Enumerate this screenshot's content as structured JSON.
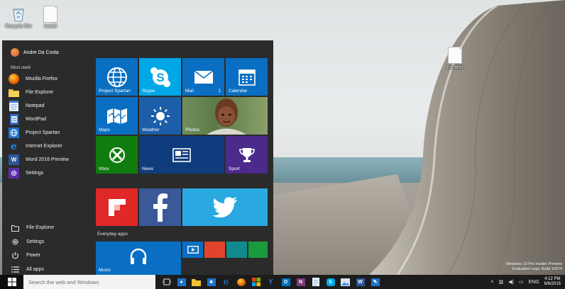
{
  "desktop": {
    "icons": [
      {
        "label": "Recycle Bin"
      },
      {
        "label": "install"
      },
      {
        "label": "contest"
      }
    ],
    "watermark_line1": "Windows 10 Pro Insider Preview",
    "watermark_line2": "Evaluation copy. Build 10074"
  },
  "start_menu": {
    "user_name": "Andre Da Costa",
    "most_used_label": "Most used",
    "most_used": [
      {
        "label": "Mozilla Firefox",
        "icon": "firefox-icon",
        "color": "#e66000"
      },
      {
        "label": "File Explorer",
        "icon": "folder-icon",
        "color": "#f1c232"
      },
      {
        "label": "Notepad",
        "icon": "notepad-icon",
        "color": "#3c7fd3"
      },
      {
        "label": "WordPad",
        "icon": "wordpad-icon",
        "color": "#2f6ec8"
      },
      {
        "label": "Project Spartan",
        "icon": "globe-icon",
        "color": "#1e73c8"
      },
      {
        "label": "Internet Explorer",
        "icon": "ie-icon",
        "color": "#1c8ae6"
      },
      {
        "label": "Word 2016 Preview",
        "icon": "word-icon",
        "color": "#2b579a"
      },
      {
        "label": "Settings",
        "icon": "gear-icon",
        "color": "#5a2ea6"
      }
    ],
    "bottom": [
      {
        "label": "File Explorer",
        "icon": "folder-icon"
      },
      {
        "label": "Settings",
        "icon": "gear-icon"
      },
      {
        "label": "Power",
        "icon": "power-icon"
      },
      {
        "label": "All apps",
        "icon": "list-icon"
      }
    ],
    "tiles": {
      "spartan": {
        "label": "Project Spartan",
        "color": "#0a6fc2"
      },
      "skype": {
        "label": "Skype",
        "color": "#00a7e6"
      },
      "mail": {
        "label": "Mail",
        "badge": "1",
        "color": "#0a6fc2"
      },
      "calendar": {
        "label": "Calendar",
        "color": "#0a6fc2"
      },
      "maps": {
        "label": "Maps",
        "color": "#0a6fc2"
      },
      "weather": {
        "label": "Weather",
        "color": "#1c5fa8"
      },
      "photos": {
        "label": "Photos"
      },
      "xbox": {
        "label": "Xbox",
        "color": "#107c10"
      },
      "news": {
        "label": "News",
        "color": "#0f3c7c"
      },
      "sport": {
        "label": "Sport",
        "color": "#4b2a8c"
      },
      "flipboard": {
        "color": "#e12828"
      },
      "facebook": {
        "color": "#3b5998"
      },
      "twitter": {
        "color": "#2aa9e0"
      },
      "music": {
        "label": "Music",
        "color": "#0a6fc2"
      },
      "small": {
        "colors": [
          "#0a6fc2",
          "#e0452b",
          "#0f8a8f",
          "#1a9a3c"
        ]
      }
    },
    "everyday_label": "Everyday apps"
  },
  "taskbar": {
    "search_placeholder": "Search the web and Windows",
    "apps": [
      {
        "icon": "task-view-icon",
        "color": "#1c1c1c"
      },
      {
        "icon": "edge-blue-icon",
        "color": "#1e73c8"
      },
      {
        "icon": "folder-icon",
        "color": "#f1c232"
      },
      {
        "icon": "store-icon",
        "color": "#1e73c8"
      },
      {
        "icon": "ie-icon",
        "color": "#1c8ae6"
      },
      {
        "icon": "firefox-icon",
        "color": "#e66000"
      },
      {
        "icon": "office-icon",
        "color": "#e24a1a"
      },
      {
        "icon": "yammer-icon",
        "color": "#3579c4"
      },
      {
        "icon": "outlook-icon",
        "color": "#0072c6"
      },
      {
        "icon": "onenote-icon",
        "color": "#80397b"
      },
      {
        "icon": "notepad-icon",
        "color": "#3c7fd3"
      },
      {
        "icon": "skype-icon",
        "color": "#00a7e6"
      },
      {
        "icon": "photos-icon",
        "color": "#4d8fd1"
      },
      {
        "icon": "word-icon",
        "color": "#2b579a"
      },
      {
        "icon": "contacts-icon",
        "color": "#1e73c8"
      }
    ],
    "language": "ENG",
    "time": "4:12 PM",
    "date": "6/6/2015"
  }
}
